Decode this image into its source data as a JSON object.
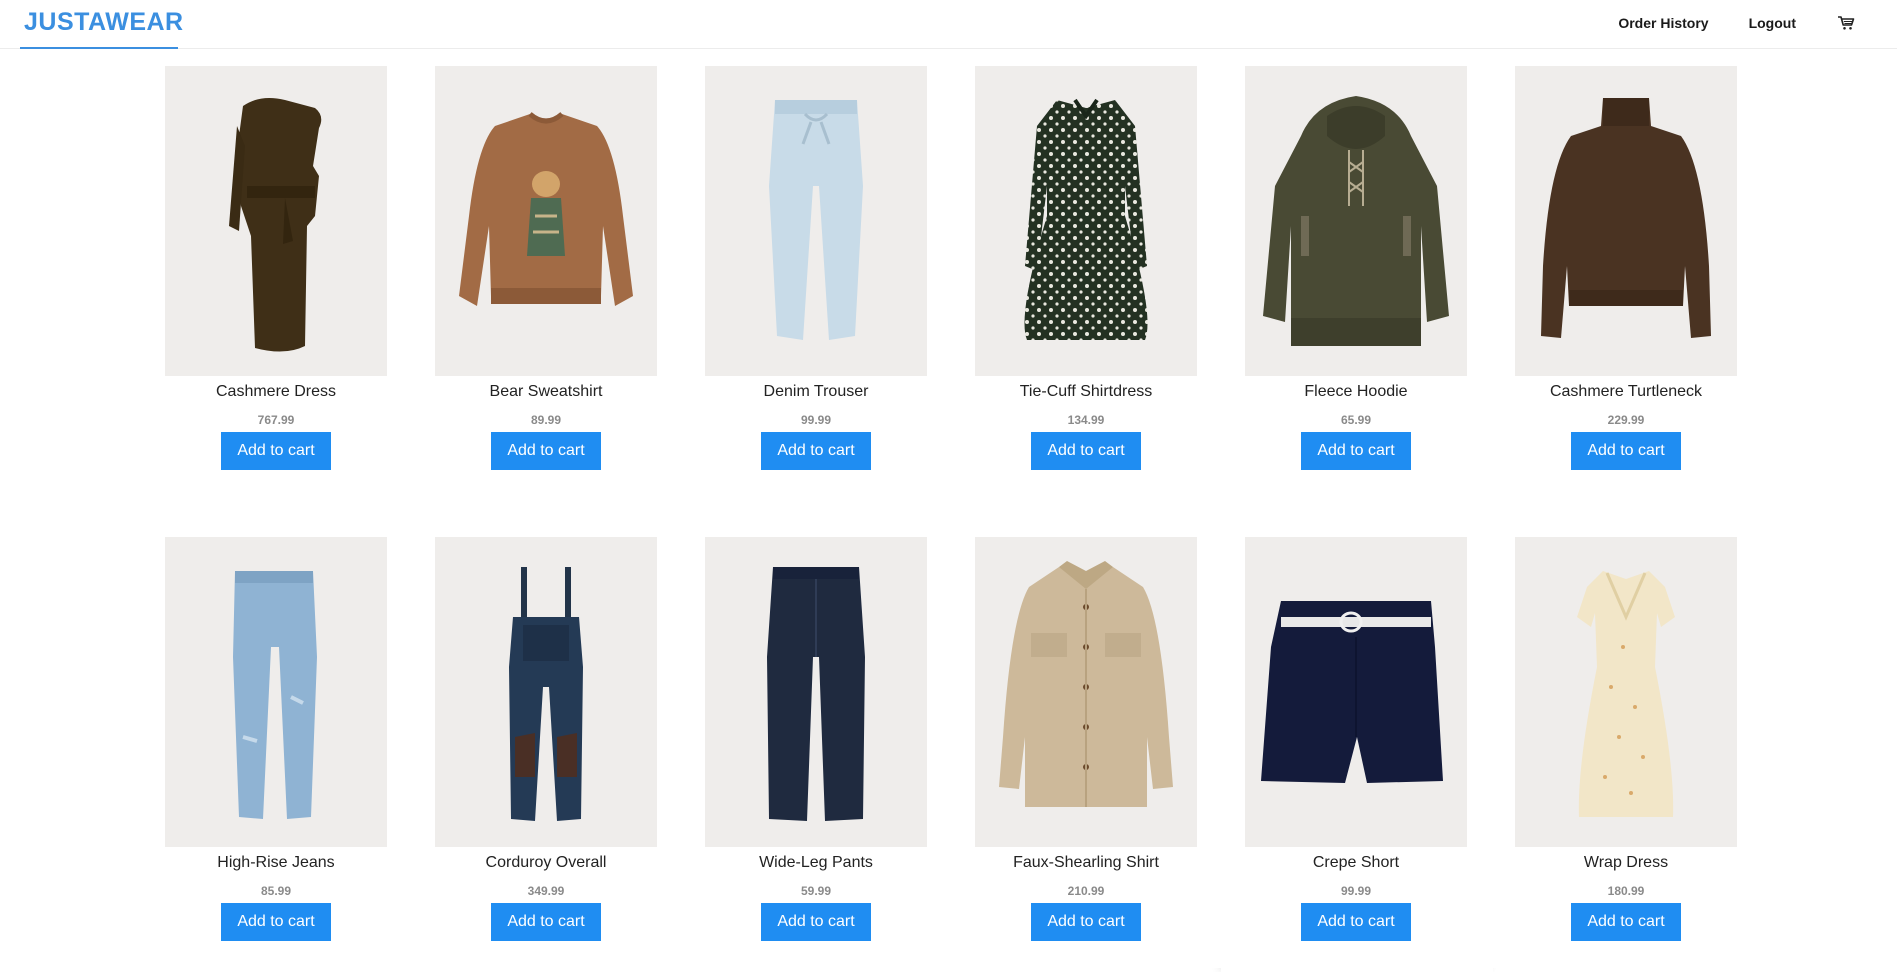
{
  "header": {
    "logo": "JUSTAWEAR",
    "nav": {
      "order_history": "Order History",
      "logout": "Logout"
    },
    "cart_icon": "cart-icon"
  },
  "colors": {
    "brand": "#3b8fe0",
    "button": "#1f8df2",
    "image_bg": "#efedeb"
  },
  "products": [
    {
      "name": "Cashmere Dress",
      "price": "767.99",
      "button": "Add to cart",
      "image": "dress-icon"
    },
    {
      "name": "Bear Sweatshirt",
      "price": "89.99",
      "button": "Add to cart",
      "image": "sweatshirt-icon"
    },
    {
      "name": "Denim Trouser",
      "price": "99.99",
      "button": "Add to cart",
      "image": "trouser-icon"
    },
    {
      "name": "Tie-Cuff Shirtdress",
      "price": "134.99",
      "button": "Add to cart",
      "image": "shirtdress-icon"
    },
    {
      "name": "Fleece Hoodie",
      "price": "65.99",
      "button": "Add to cart",
      "image": "hoodie-icon"
    },
    {
      "name": "Cashmere Turtleneck",
      "price": "229.99",
      "button": "Add to cart",
      "image": "turtleneck-icon"
    },
    {
      "name": "High-Rise Jeans",
      "price": "85.99",
      "button": "Add to cart",
      "image": "jeans-icon"
    },
    {
      "name": "Corduroy Overall",
      "price": "349.99",
      "button": "Add to cart",
      "image": "overall-icon"
    },
    {
      "name": "Wide-Leg Pants",
      "price": "59.99",
      "button": "Add to cart",
      "image": "pants-icon"
    },
    {
      "name": "Faux-Shearling Shirt",
      "price": "210.99",
      "button": "Add to cart",
      "image": "shirt-icon"
    },
    {
      "name": "Crepe Short",
      "price": "99.99",
      "button": "Add to cart",
      "image": "shorts-icon"
    },
    {
      "name": "Wrap Dress",
      "price": "180.99",
      "button": "Add to cart",
      "image": "wrap-dress-icon"
    }
  ]
}
